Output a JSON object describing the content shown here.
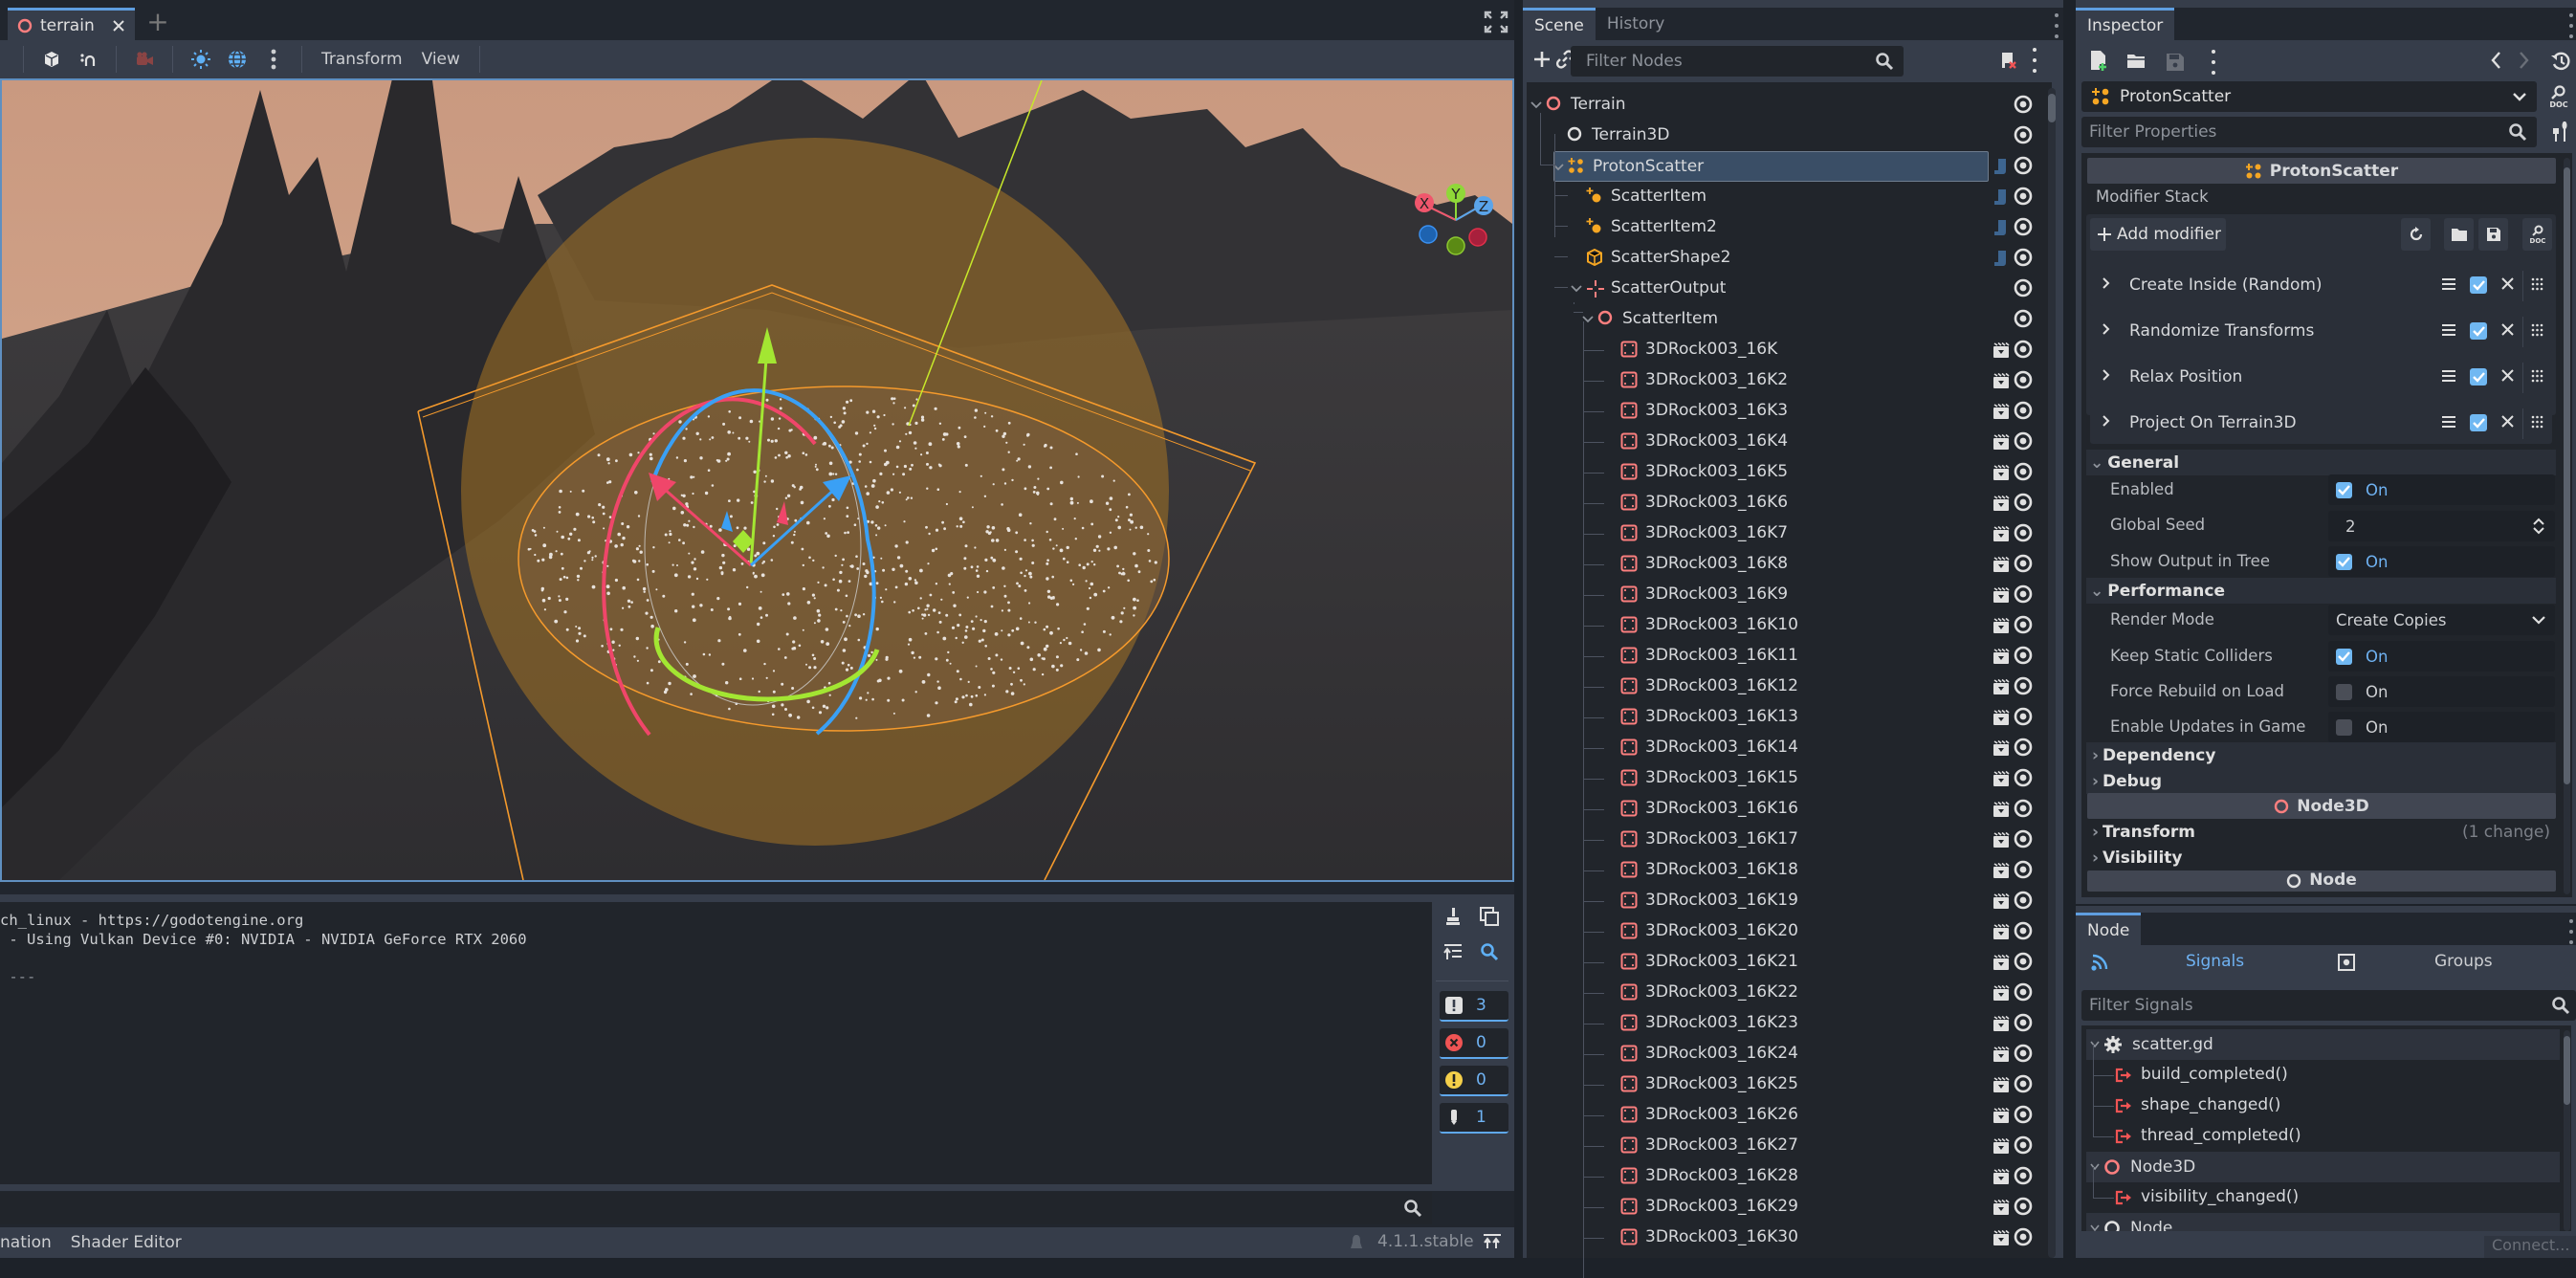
{
  "editor": {
    "scene_tab": {
      "label": "terrain",
      "icon": "node3d-icon"
    },
    "add_tab_label": "+",
    "toolbar": {
      "icons": [
        "select-cube-icon",
        "snap-magnet-icon",
        "camera-icon",
        "sun-icon",
        "environment-globe-icon",
        "more-vert-icon"
      ],
      "menus": [
        "Transform",
        "View"
      ]
    },
    "viewport": {
      "gizmo_axes": [
        "X",
        "Y",
        "Z"
      ],
      "axis_colors": {
        "x": "#f0566c",
        "y": "#8fd838",
        "z": "#5aa4ea"
      }
    }
  },
  "output": {
    "lines": [
      "ch_linux - https://godotengine.org",
      " - Using Vulkan Device #0: NVIDIA - NVIDIA GeForce RTX 2060",
      "",
      " ---"
    ],
    "filter_placeholder": "",
    "counters": [
      {
        "kind": "message",
        "count": "3"
      },
      {
        "kind": "error",
        "count": "0"
      },
      {
        "kind": "warning",
        "count": "0"
      },
      {
        "kind": "editor",
        "count": "1"
      }
    ]
  },
  "statusbar": {
    "tabs": [
      "nation",
      "Shader Editor"
    ],
    "version": "4.1.1.stable"
  },
  "scene_dock": {
    "tabs": [
      "Scene",
      "History"
    ],
    "active_tab": "Scene",
    "filter_placeholder": "Filter Nodes",
    "tree": [
      {
        "label": "Terrain",
        "icon": "node3d",
        "depth": 0,
        "expanded": true
      },
      {
        "label": "Terrain3D",
        "icon": "node-white",
        "depth": 1
      },
      {
        "label": "ProtonScatter",
        "icon": "scatter",
        "depth": 1,
        "expanded": true,
        "selected": true,
        "script": true
      },
      {
        "label": "ScatterItem",
        "icon": "scatter-item",
        "depth": 2,
        "script": true
      },
      {
        "label": "ScatterItem2",
        "icon": "scatter-item",
        "depth": 2,
        "script": true
      },
      {
        "label": "ScatterShape2",
        "icon": "scatter-shape",
        "depth": 2,
        "script": true
      },
      {
        "label": "ScatterOutput",
        "icon": "scatter-output",
        "depth": 2,
        "expanded": true
      },
      {
        "label": "ScatterItem",
        "icon": "node3d",
        "depth": 3,
        "expanded": true
      },
      {
        "label": "3DRock003_16K",
        "icon": "mesh",
        "depth": 4,
        "instance": true
      },
      {
        "label": "3DRock003_16K2",
        "icon": "mesh",
        "depth": 4,
        "instance": true
      },
      {
        "label": "3DRock003_16K3",
        "icon": "mesh",
        "depth": 4,
        "instance": true
      },
      {
        "label": "3DRock003_16K4",
        "icon": "mesh",
        "depth": 4,
        "instance": true
      },
      {
        "label": "3DRock003_16K5",
        "icon": "mesh",
        "depth": 4,
        "instance": true
      },
      {
        "label": "3DRock003_16K6",
        "icon": "mesh",
        "depth": 4,
        "instance": true
      },
      {
        "label": "3DRock003_16K7",
        "icon": "mesh",
        "depth": 4,
        "instance": true
      },
      {
        "label": "3DRock003_16K8",
        "icon": "mesh",
        "depth": 4,
        "instance": true
      },
      {
        "label": "3DRock003_16K9",
        "icon": "mesh",
        "depth": 4,
        "instance": true
      },
      {
        "label": "3DRock003_16K10",
        "icon": "mesh",
        "depth": 4,
        "instance": true
      },
      {
        "label": "3DRock003_16K11",
        "icon": "mesh",
        "depth": 4,
        "instance": true
      },
      {
        "label": "3DRock003_16K12",
        "icon": "mesh",
        "depth": 4,
        "instance": true
      },
      {
        "label": "3DRock003_16K13",
        "icon": "mesh",
        "depth": 4,
        "instance": true
      },
      {
        "label": "3DRock003_16K14",
        "icon": "mesh",
        "depth": 4,
        "instance": true
      },
      {
        "label": "3DRock003_16K15",
        "icon": "mesh",
        "depth": 4,
        "instance": true
      },
      {
        "label": "3DRock003_16K16",
        "icon": "mesh",
        "depth": 4,
        "instance": true
      },
      {
        "label": "3DRock003_16K17",
        "icon": "mesh",
        "depth": 4,
        "instance": true
      },
      {
        "label": "3DRock003_16K18",
        "icon": "mesh",
        "depth": 4,
        "instance": true
      },
      {
        "label": "3DRock003_16K19",
        "icon": "mesh",
        "depth": 4,
        "instance": true
      },
      {
        "label": "3DRock003_16K20",
        "icon": "mesh",
        "depth": 4,
        "instance": true
      },
      {
        "label": "3DRock003_16K21",
        "icon": "mesh",
        "depth": 4,
        "instance": true
      },
      {
        "label": "3DRock003_16K22",
        "icon": "mesh",
        "depth": 4,
        "instance": true
      },
      {
        "label": "3DRock003_16K23",
        "icon": "mesh",
        "depth": 4,
        "instance": true
      },
      {
        "label": "3DRock003_16K24",
        "icon": "mesh",
        "depth": 4,
        "instance": true
      },
      {
        "label": "3DRock003_16K25",
        "icon": "mesh",
        "depth": 4,
        "instance": true
      },
      {
        "label": "3DRock003_16K26",
        "icon": "mesh",
        "depth": 4,
        "instance": true
      },
      {
        "label": "3DRock003_16K27",
        "icon": "mesh",
        "depth": 4,
        "instance": true
      },
      {
        "label": "3DRock003_16K28",
        "icon": "mesh",
        "depth": 4,
        "instance": true
      },
      {
        "label": "3DRock003_16K29",
        "icon": "mesh",
        "depth": 4,
        "instance": true
      },
      {
        "label": "3DRock003_16K30",
        "icon": "mesh",
        "depth": 4,
        "instance": true
      }
    ]
  },
  "inspector": {
    "tab": "Inspector",
    "selected_object": "ProtonScatter",
    "filter_placeholder": "Filter Properties",
    "class_header": "ProtonScatter",
    "modifier_stack": {
      "label": "Modifier Stack",
      "add_button": "Add modifier",
      "modifiers": [
        {
          "name": "Create Inside (Random)",
          "enabled": true
        },
        {
          "name": "Randomize Transforms",
          "enabled": true
        },
        {
          "name": "Relax Position",
          "enabled": true
        },
        {
          "name": "Project On Terrain3D",
          "enabled": true
        }
      ]
    },
    "sections": {
      "general": "General",
      "performance": "Performance",
      "dependency": "Dependency",
      "debug": "Debug",
      "transform": "Transform",
      "transform_note": "(1 change)",
      "visibility": "Visibility"
    },
    "properties": {
      "enabled": {
        "label": "Enabled",
        "value": true,
        "text": "On"
      },
      "global_seed": {
        "label": "Global Seed",
        "value": "2"
      },
      "show_output": {
        "label": "Show Output in Tree",
        "value": true,
        "text": "On"
      },
      "render_mode": {
        "label": "Render Mode",
        "value": "Create Copies"
      },
      "keep_colliders": {
        "label": "Keep Static Colliders",
        "value": true,
        "text": "On"
      },
      "force_rebuild": {
        "label": "Force Rebuild on Load",
        "value": false,
        "text": "On"
      },
      "enable_updates": {
        "label": "Enable Updates in Game",
        "value": false,
        "text": "On"
      }
    },
    "node3d_header": "Node3D",
    "node_header": "Node"
  },
  "node_dock": {
    "tab": "Node",
    "subtabs": [
      "Signals",
      "Groups"
    ],
    "active_subtab": "Signals",
    "filter_placeholder": "Filter Signals",
    "groups": [
      {
        "name": "scatter.gd",
        "icon": "gear-icon",
        "signals": [
          "build_completed()",
          "shape_changed()",
          "thread_completed()"
        ]
      },
      {
        "name": "Node3D",
        "icon": "node3d-icon",
        "signals": [
          "visibility_changed()"
        ]
      },
      {
        "name": "Node",
        "icon": "node-icon",
        "signals": []
      }
    ],
    "connect_button": "Connect..."
  }
}
